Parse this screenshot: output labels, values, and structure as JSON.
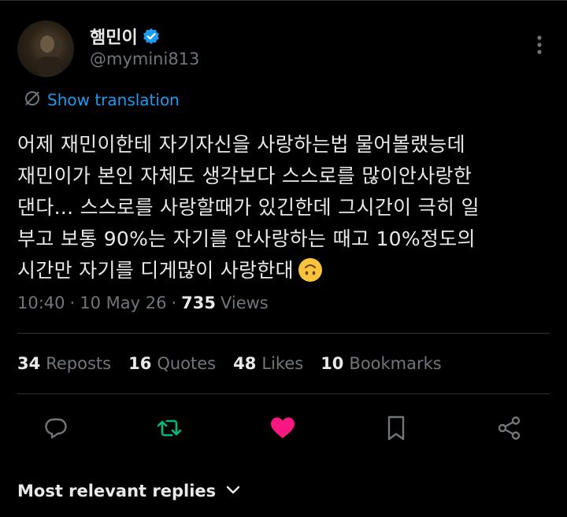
{
  "author": {
    "display_name": "햄민이",
    "handle": "@mymini813",
    "verified": true
  },
  "translate": {
    "label": "Show translation",
    "icon": "translate-icon"
  },
  "tweet": {
    "lines": [
      "어제 재민이한테 자기자신을 사랑하는법 물어볼랬능데",
      "재민이가 본인 자체도 생각보다 스스로를 많이안사랑한",
      "댄다... 스스로를 사랑할때가 있긴한데 그시간이 극히 일",
      "부고 보통 90%는 자기를 안사랑하는 때고 10%정도의",
      "시간만 자기를 디게많이 사랑한대"
    ],
    "emoji": "upside-down-face"
  },
  "meta": {
    "time": "10:40",
    "sep1": "·",
    "date": "10 May 26",
    "sep2": "·",
    "views_count": "735",
    "views_label": "Views"
  },
  "stats": {
    "reposts_count": "34",
    "reposts_label": "Reposts",
    "quotes_count": "16",
    "quotes_label": "Quotes",
    "likes_count": "48",
    "likes_label": "Likes",
    "bookmarks_count": "10",
    "bookmarks_label": "Bookmarks"
  },
  "actions": {
    "reply_icon": "reply-icon",
    "repost_icon": "repost-icon",
    "like_icon": "heart-icon",
    "bookmark_icon": "bookmark-icon",
    "share_icon": "share-icon"
  },
  "replies": {
    "label": "Most relevant replies",
    "icon": "chevron-down-icon"
  },
  "colors": {
    "background": "#000000",
    "text": "#e7e9ea",
    "muted": "#71767b",
    "accent_blue": "#1d9bf0",
    "repost_green": "#00ba7c",
    "like_pink": "#f91880",
    "divider": "#2f3336"
  }
}
